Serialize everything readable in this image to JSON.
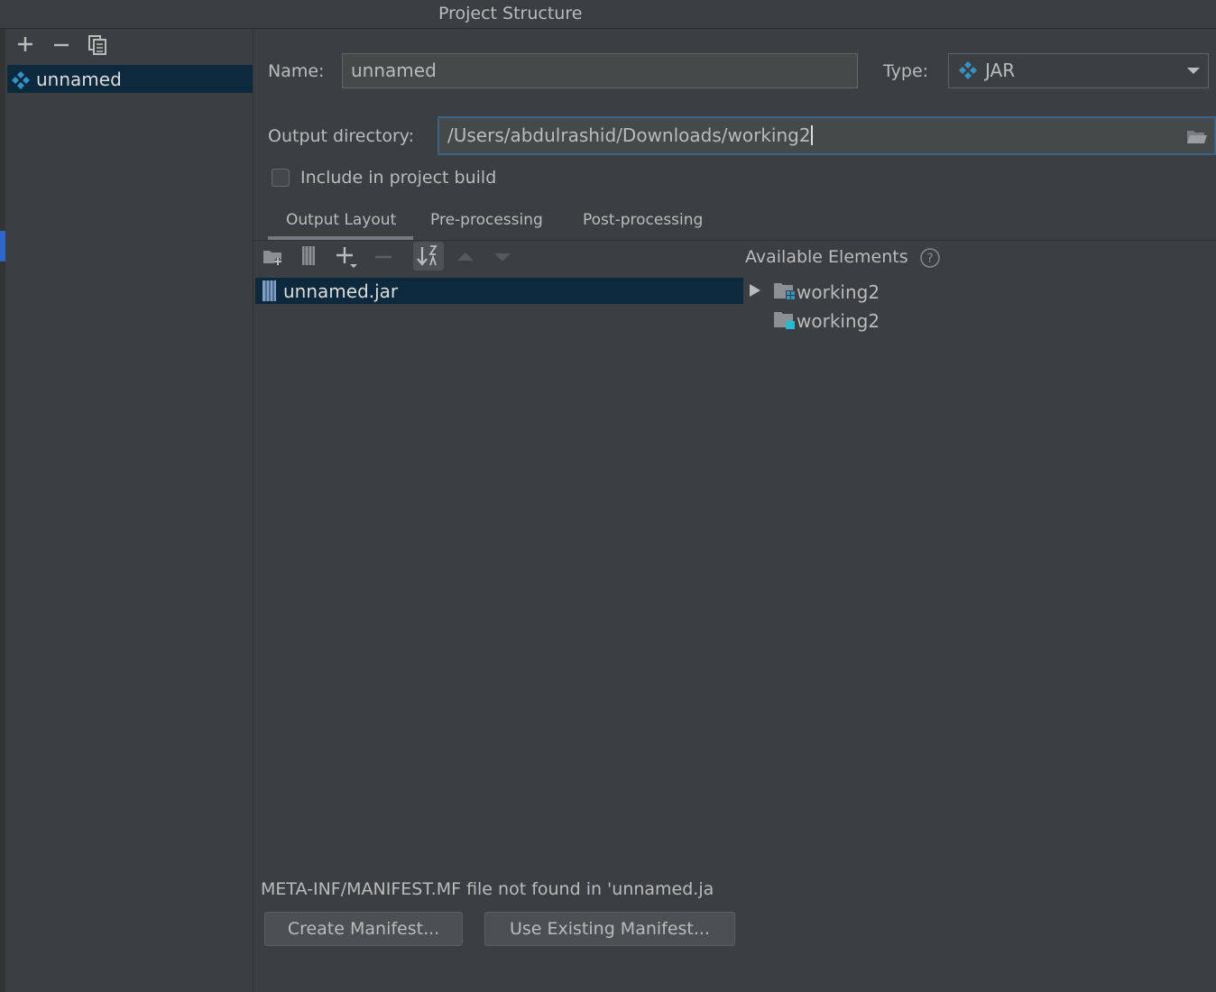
{
  "window": {
    "title": "Project Structure"
  },
  "artifacts": {
    "items": [
      {
        "label": "unnamed"
      }
    ]
  },
  "form": {
    "name_label": "Name:",
    "name_value": "unnamed",
    "type_label": "Type:",
    "type_value": "JAR",
    "output_label": "Output directory:",
    "output_value": "/Users/abdulrashid/Downloads/working2",
    "include_label": "Include in project build",
    "include_checked": false
  },
  "tabs": [
    {
      "label": "Output Layout",
      "active": true
    },
    {
      "label": "Pre-processing",
      "active": false
    },
    {
      "label": "Post-processing",
      "active": false
    }
  ],
  "layout": {
    "root": "unnamed.jar"
  },
  "available": {
    "title": "Available Elements",
    "items": [
      {
        "label": "working2",
        "expandable": true
      },
      {
        "label": "working2",
        "expandable": false
      }
    ]
  },
  "manifest": {
    "message": "META-INF/MANIFEST.MF file not found in 'unnamed.ja",
    "create_label": "Create Manifest...",
    "use_label": "Use Existing Manifest..."
  },
  "colors": {
    "selection": "#0d293e",
    "focus": "#3d6185",
    "background": "#3c3f41",
    "artifact_icon": "#3592c4"
  },
  "icons": [
    "add-icon",
    "remove-icon",
    "copy-icon",
    "artifact-icon",
    "dropdown-arrow-icon",
    "folder-browse-icon",
    "new-directory-icon",
    "archive-icon",
    "add-copy-icon",
    "sort-icon",
    "move-up-icon",
    "move-down-icon",
    "help-icon",
    "expand-arrow-icon",
    "module-folder-icon"
  ]
}
